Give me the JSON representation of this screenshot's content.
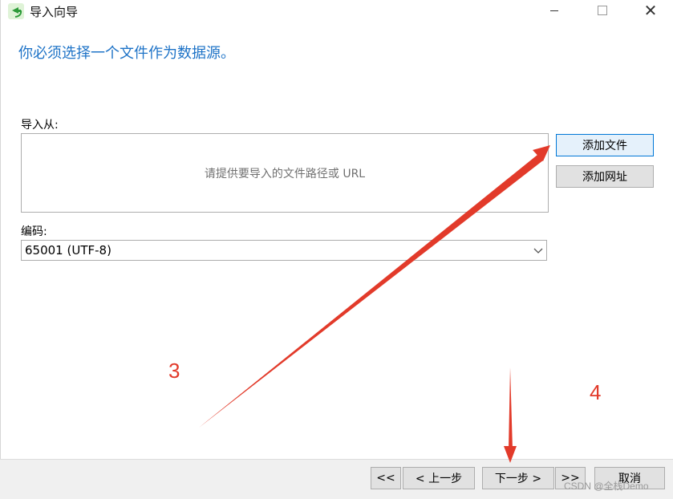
{
  "window": {
    "title": "导入向导",
    "icon": "import-wizard-icon"
  },
  "heading": "你必须选择一个文件作为数据源。",
  "import_from": {
    "label": "导入从:",
    "placeholder": "请提供要导入的文件路径或 URL"
  },
  "side_buttons": {
    "add_file": "添加文件",
    "add_url": "添加网址"
  },
  "encoding": {
    "label": "编码:",
    "selected": "65001 (UTF-8)"
  },
  "footer": {
    "first": "<<",
    "prev": "< 上一步",
    "next": "下一步 >",
    "last": ">>",
    "cancel": "取消"
  },
  "annotations": {
    "step_3": "3",
    "step_4": "4",
    "color": "#e23a2a"
  },
  "watermark": "CSDN @全栈Demo",
  "colors": {
    "heading": "#1e73c7",
    "footer_bg": "#f0f0f0",
    "focus_border": "#0078d7"
  }
}
